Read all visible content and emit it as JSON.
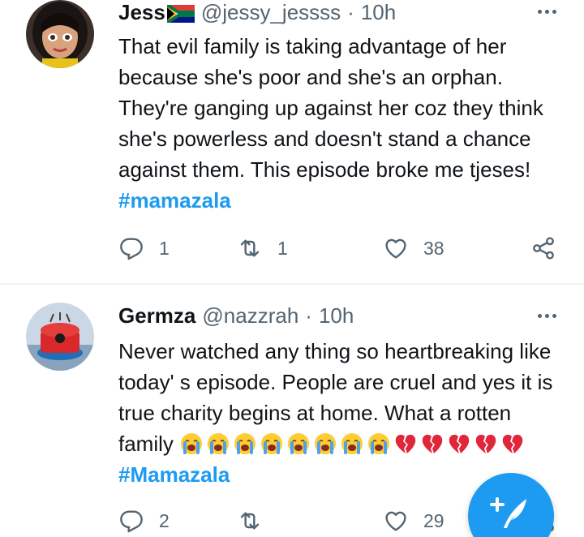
{
  "tweets": [
    {
      "name": "Jess",
      "handle": "@jessy_jessss",
      "separator": "·",
      "time": "10h",
      "text": "That evil family is taking advantage of her because she's poor and she's an orphan. They're ganging up against her coz they think she's powerless and doesn't stand a chance against them. This episode broke me tjeses! ",
      "hashtag": "#mamazala",
      "replies": "1",
      "retweets": "1",
      "likes": "38"
    },
    {
      "name": "Germza",
      "handle": "@nazzrah",
      "separator": "·",
      "time": "10h",
      "text": "Never watched any thing so heartbreaking like today' s episode.  People are cruel and yes it is true charity begins at home. What a rotten family ",
      "emoji": [
        "😭",
        "😭",
        "😭",
        "😭",
        "😭",
        "😭",
        "😭",
        "😭",
        "💔",
        "💔",
        "💔",
        "💔",
        "💔"
      ],
      "hashtag": "#Mamazala",
      "replies": "2",
      "retweets": "",
      "likes": "29"
    }
  ],
  "colors": {
    "accent": "#1d9bf0",
    "text": "#0f1419",
    "secondary": "#536471",
    "divider": "#eff3f4"
  },
  "icons": [
    "reply-icon",
    "retweet-icon",
    "like-icon",
    "share-icon",
    "more-icon",
    "compose-icon",
    "south-africa-flag-icon",
    "crying-face-emoji",
    "broken-heart-emoji"
  ]
}
